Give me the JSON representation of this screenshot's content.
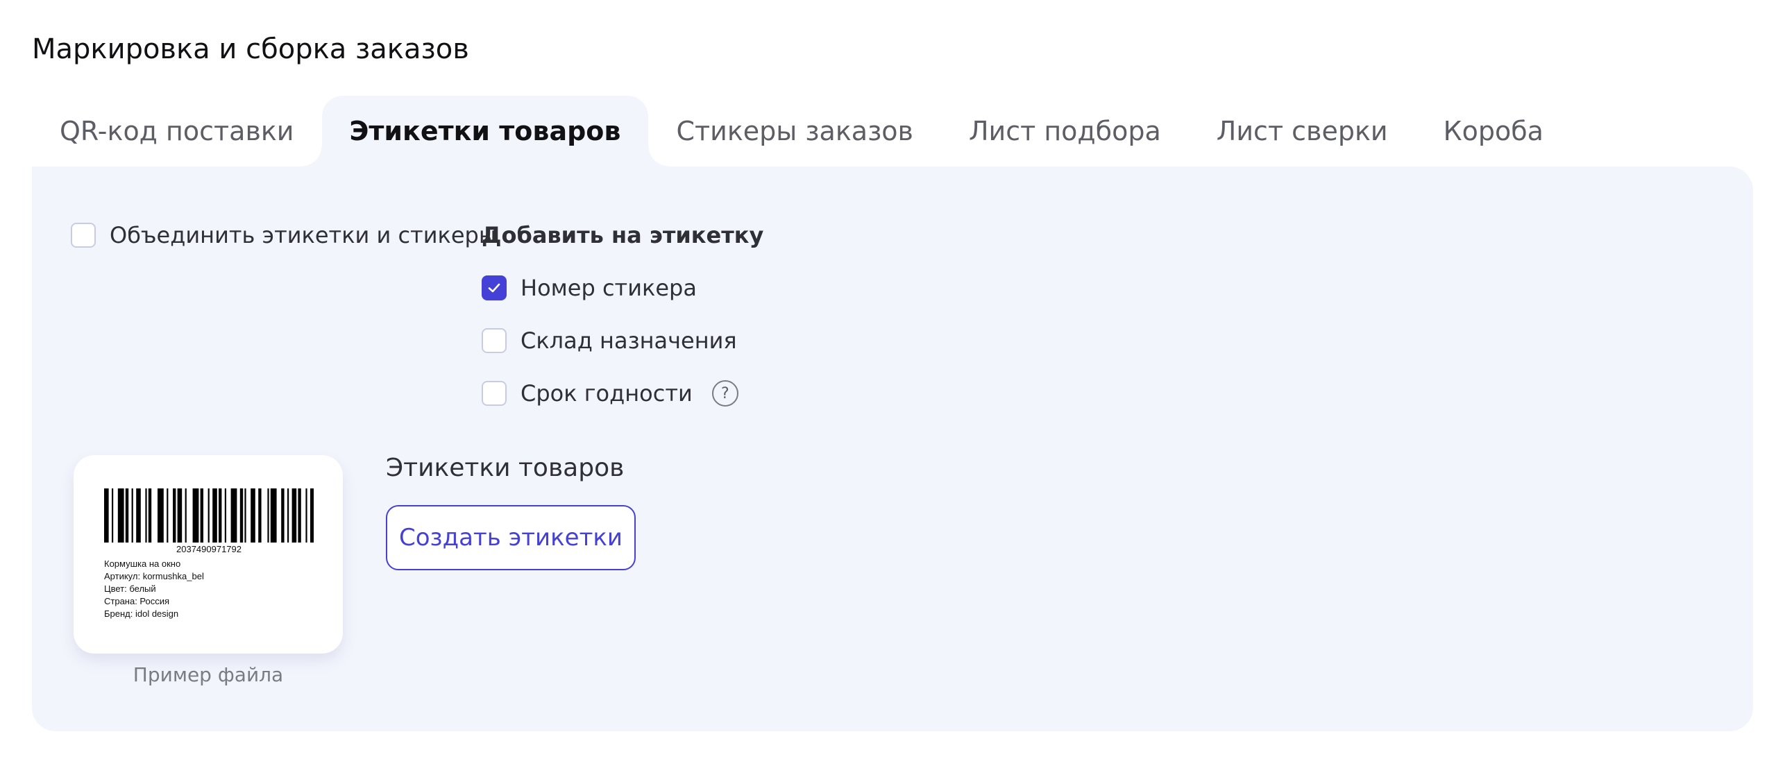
{
  "page": {
    "title": "Маркировка и сборка заказов"
  },
  "tabs": [
    {
      "label": "QR-код поставки",
      "active": false
    },
    {
      "label": "Этикетки товаров",
      "active": true
    },
    {
      "label": "Стикеры заказов",
      "active": false
    },
    {
      "label": "Лист подбора",
      "active": false
    },
    {
      "label": "Лист сверки",
      "active": false
    },
    {
      "label": "Короба",
      "active": false
    }
  ],
  "options": {
    "merge": {
      "label": "Объединить этикетки и стикеры",
      "checked": false
    },
    "add_to_label_title": "Добавить на этикетку",
    "items": [
      {
        "label": "Номер стикера",
        "checked": true
      },
      {
        "label": "Склад назначения",
        "checked": false
      },
      {
        "label": "Срок годности",
        "checked": false,
        "help_icon": "question-circle-icon"
      }
    ]
  },
  "preview": {
    "barcode_number": "2037490971792",
    "lines": [
      "Кормушка на окно",
      "Артикул: kormushka_bel",
      "Цвет: белый",
      "Страна: Россия",
      "Бренд: idol design"
    ],
    "caption": "Пример файла"
  },
  "generate": {
    "heading": "Этикетки товаров",
    "button_label": "Создать этикетки"
  },
  "colors": {
    "accent": "#4540d6",
    "panel_background": "#f3f5fd",
    "muted_text": "#7b7b84"
  }
}
